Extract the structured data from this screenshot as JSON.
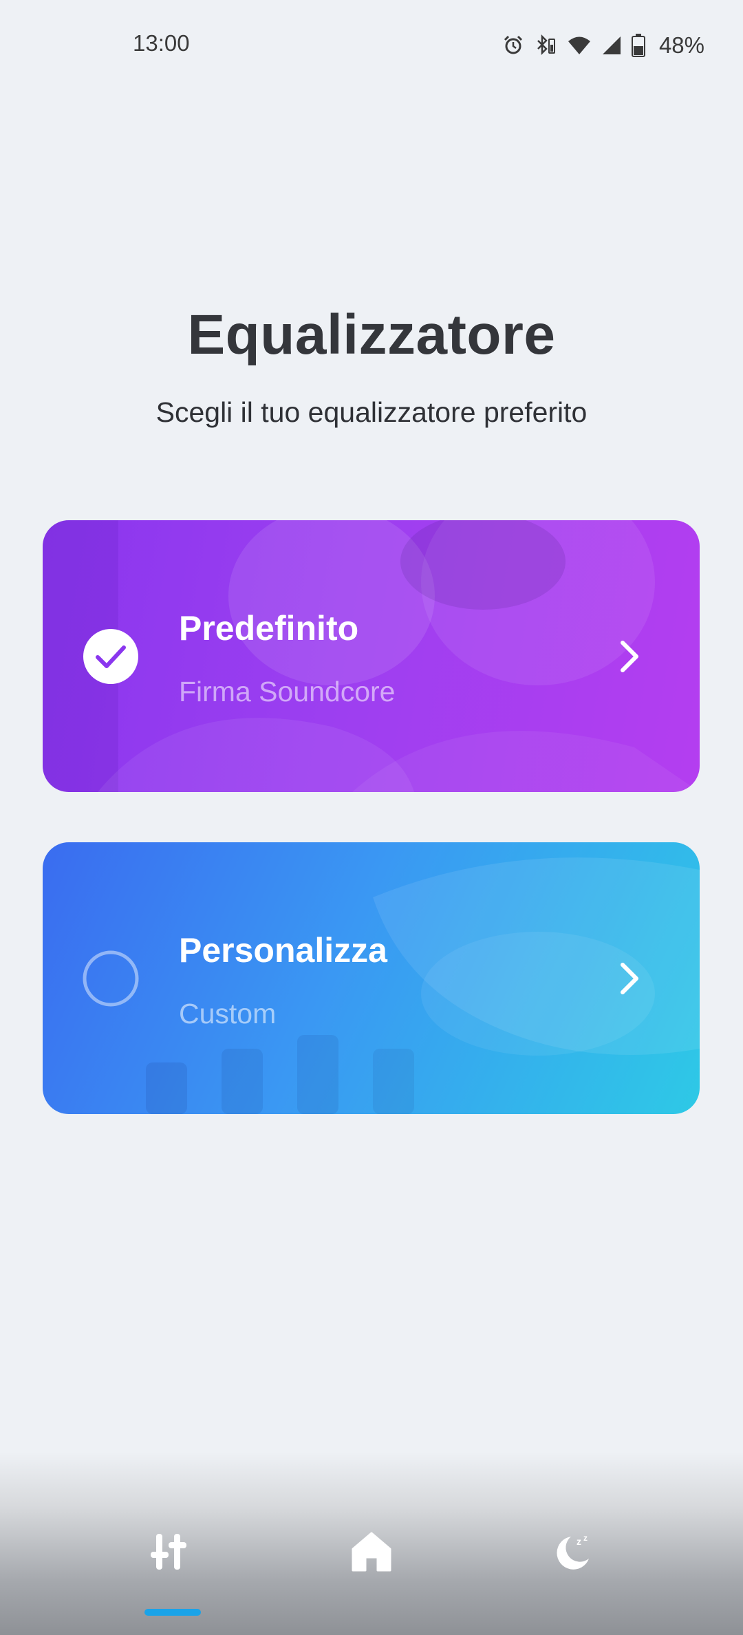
{
  "status": {
    "time": "13:00",
    "battery": "48%",
    "icons": [
      "alarm-icon",
      "bluetooth-icon",
      "wifi-icon",
      "signal-icon",
      "battery-icon"
    ]
  },
  "header": {
    "title": "Equalizzatore",
    "subtitle": "Scegli il tuo equalizzatore preferito"
  },
  "cards": [
    {
      "title": "Predefinito",
      "subtitle": "Firma Soundcore",
      "selected": true
    },
    {
      "title": "Personalizza",
      "subtitle": "Custom",
      "selected": false
    }
  ],
  "nav": {
    "items": [
      "equalizer-icon",
      "home-icon",
      "sleep-icon"
    ],
    "active": "equalizer",
    "accent": "#1aa3e8"
  },
  "colors": {
    "card_default": "#9c3ff0",
    "card_custom": "#3a98f3"
  }
}
